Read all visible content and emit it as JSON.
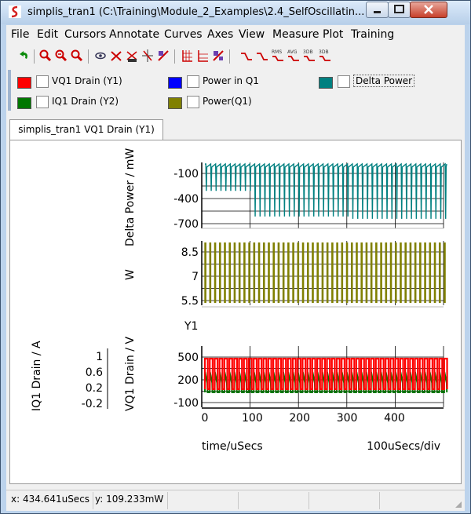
{
  "window": {
    "title": "simplis_tran1 (C:\\Training\\Module_2_Examples\\2.4_SelfOscillatin...",
    "buttons": [
      "minimize-button",
      "maximize-button",
      "close-button"
    ]
  },
  "menu": [
    {
      "id": "file",
      "label": "File"
    },
    {
      "id": "edit",
      "label": "Edit"
    },
    {
      "id": "cursors",
      "label": "Cursors"
    },
    {
      "id": "annotate",
      "label": "Annotate"
    },
    {
      "id": "curves",
      "label": "Curves"
    },
    {
      "id": "axes",
      "label": "Axes"
    },
    {
      "id": "view",
      "label": "View"
    },
    {
      "id": "measure",
      "label": "Measure"
    },
    {
      "id": "plot",
      "label": "Plot"
    },
    {
      "id": "training",
      "label": "Training"
    }
  ],
  "toolbar_icons": [
    "undo-icon",
    "zoom-in-icon",
    "zoom-out-icon",
    "zoom-fit-icon",
    "view-icon",
    "delete-curve-icon",
    "curve-name-icon",
    "cursor-icon",
    "edit-curve-icon",
    "grid-icon",
    "axis-icon",
    "stack-icon",
    "measure-rise-icon",
    "measure-fall-icon",
    "measure-rms-icon",
    "measure-avg-icon",
    "measure-3db-high-icon",
    "measure-3db-low-icon"
  ],
  "toolbar_labels": {
    "rms": "RMS",
    "avg": "AVG",
    "db1": "3DB",
    "db2": "3DB"
  },
  "legend": [
    {
      "label": "VQ1 Drain (Y1)",
      "color": "#ff0000"
    },
    {
      "label": "IQ1 Drain (Y2)",
      "color": "#007700"
    },
    {
      "label": "Power in Q1",
      "color": "#0000ff"
    },
    {
      "label": "Power(Q1)",
      "color": "#808000"
    },
    {
      "label": "Delta Power",
      "color": "#008080"
    }
  ],
  "tab": {
    "label": "simplis_tran1 VQ1 Drain (Y1)"
  },
  "chart_data": [
    {
      "type": "line",
      "id": "delta-power",
      "ylabel": "Delta Power / mW",
      "y_ticks": [
        "-100",
        "-400",
        "-700"
      ],
      "ylim": [
        -750,
        50
      ],
      "series": [
        {
          "name": "Delta Power",
          "color": "#008080"
        }
      ]
    },
    {
      "type": "line",
      "id": "power-q1",
      "ylabel": "W",
      "y_ticks": [
        "8.5",
        "7",
        "5.5"
      ],
      "ylim": [
        5,
        9.5
      ],
      "series": [
        {
          "name": "Power(Q1)",
          "color": "#808000"
        }
      ]
    },
    {
      "type": "line",
      "id": "vq1-iq1",
      "axis_label": "Y1",
      "ylabel": "VQ1 Drain / V",
      "y_ticks": [
        "500",
        "200",
        "-100"
      ],
      "ylim": [
        -100,
        600
      ],
      "y2label": "IQ1 Drain / A",
      "y2_ticks": [
        "1",
        "0.6",
        "0.2",
        "-0.2"
      ],
      "x_ticks": [
        "0",
        "100",
        "200",
        "300",
        "400"
      ],
      "xlim": [
        0,
        500
      ],
      "xlabel": "time/uSecs",
      "xdiv": "100uSecs/div",
      "series": [
        {
          "name": "VQ1 Drain (Y1)",
          "color": "#ff0000",
          "high": 410,
          "low": -60,
          "period": 20.4
        },
        {
          "name": "IQ1 Drain (Y2)",
          "color": "#007700"
        }
      ]
    }
  ],
  "status": {
    "x": "x: 434.641uSecs",
    "y": "y: 109.233mW"
  }
}
